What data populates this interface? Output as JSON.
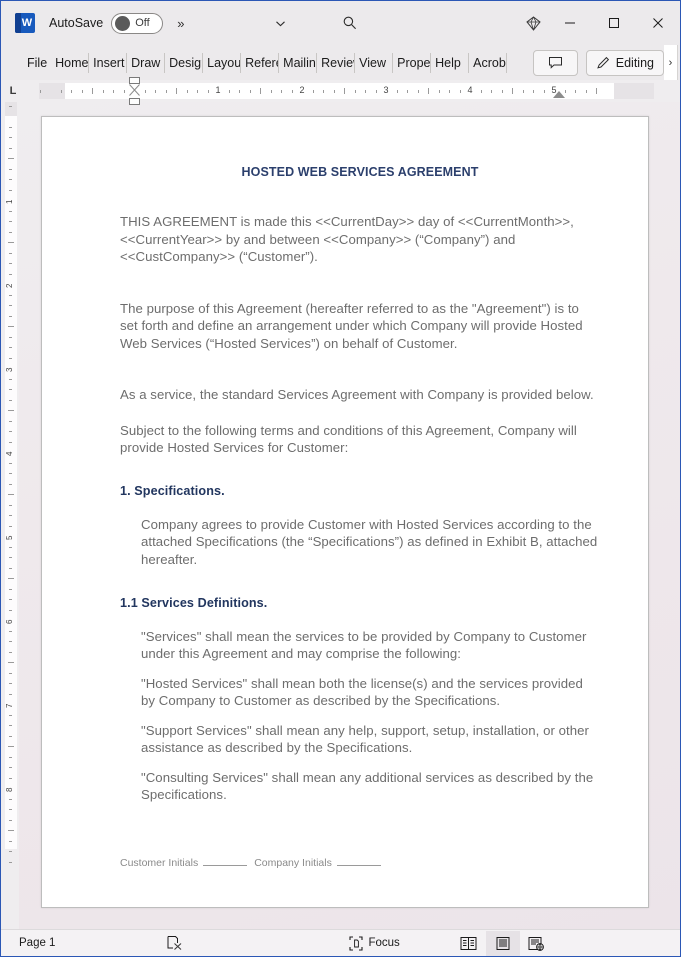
{
  "titlebar": {
    "app_icon": "word-logo-icon",
    "app_initial": "W",
    "autosave_label": "AutoSave",
    "autosave_state": "Off",
    "more_commands": "»",
    "quick_access_chevron": "chevron-down-icon",
    "search_icon": "search-icon",
    "copilot_icon": "diamond-icon",
    "minimize": "minimize-icon",
    "maximize": "maximize-icon",
    "close": "close-icon"
  },
  "ribbon": {
    "tabs": [
      {
        "label": "File",
        "truncated": false
      },
      {
        "label": "Home",
        "truncated": true
      },
      {
        "label": "Insert",
        "truncated": true
      },
      {
        "label": "Draw",
        "truncated": false
      },
      {
        "label": "Design",
        "truncated": true
      },
      {
        "label": "Layout",
        "truncated": true
      },
      {
        "label": "References",
        "truncated": true
      },
      {
        "label": "Mailings",
        "truncated": true
      },
      {
        "label": "Review",
        "truncated": true
      },
      {
        "label": "View",
        "truncated": false
      },
      {
        "label": "Properties",
        "truncated": true
      },
      {
        "label": "Help",
        "truncated": false
      },
      {
        "label": "Acrobat",
        "truncated": true
      }
    ],
    "comments_button": "comments-icon",
    "editing_button": "Editing",
    "editing_pencil": "pencil-icon",
    "overflow_chevron": "›"
  },
  "ruler": {
    "tab_stop_selector": "L",
    "horizontal_numbers": [
      "1",
      "2",
      "3",
      "4",
      "5"
    ],
    "vertical_numbers": [
      "1",
      "2",
      "3",
      "4",
      "5",
      "6",
      "7",
      "8"
    ]
  },
  "document": {
    "title": "HOSTED WEB SERVICES AGREEMENT",
    "paragraphs": [
      "THIS AGREEMENT is made this <<CurrentDay>> day of <<CurrentMonth>>, <<CurrentYear>> by and between <<Company>> (“Company”) and <<CustCompany>> (“Customer”).",
      "The purpose of this Agreement (hereafter referred to as the \"Agreement\") is to set forth and define an arrangement under which Company will provide Hosted Web Services (“Hosted Services”) on behalf of Customer.",
      "As a service, the standard Services Agreement with Company is provided below.",
      "Subject to the following terms and conditions of this Agreement, Company will provide Hosted Services for Customer:"
    ],
    "heading_1": "1. Specifications.",
    "specifications_body": "Company agrees to provide Customer with Hosted Services according to the attached Specifications (the “Specifications”) as defined in Exhibit B, attached hereafter.",
    "heading_1_1": "1.1 Services Definitions.",
    "definitions": [
      "\"Services\" shall mean the services to be provided by Company to Customer under this Agreement and may comprise the following:",
      "\"Hosted Services\" shall mean both the license(s) and the services provided by Company to Customer as described by the Specifications.",
      "\"Support Services\" shall mean any help, support, setup, installation, or other assistance as described by the Specifications.",
      "\"Consulting Services\" shall mean any additional services as described by the Specifications."
    ],
    "footer": {
      "customer_initials_label": "Customer Initials",
      "company_initials_label": "Company Initials"
    },
    "title_color": "#2b3f6c",
    "heading_color": "#22365f",
    "body_color": "#6d6d6d"
  },
  "statusbar": {
    "page_label": "Page 1",
    "proofing_icon": "proofing-errors-icon",
    "focus_label": "Focus",
    "focus_icon": "focus-icon",
    "view_read_mode": "read-mode-icon",
    "view_print_layout": "print-layout-icon",
    "view_web_layout": "web-layout-icon",
    "active_view": "print-layout-icon"
  }
}
